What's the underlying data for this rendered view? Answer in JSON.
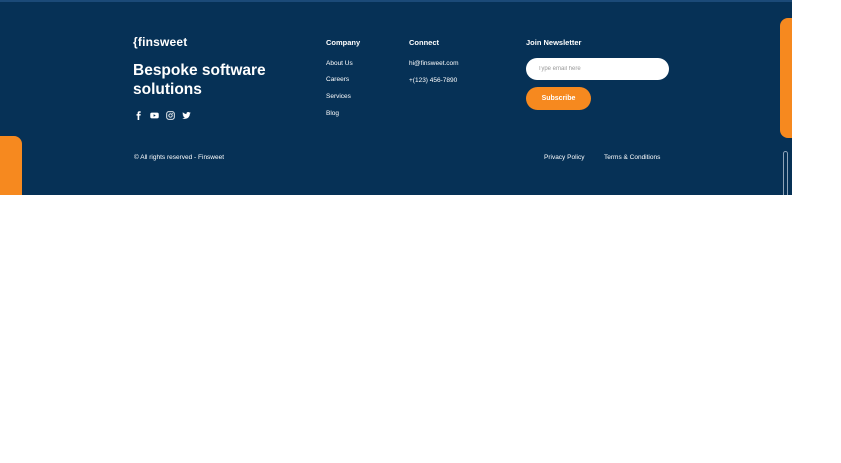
{
  "brand": {
    "logo": "{finsweet",
    "tagline": "Bespoke software solutions"
  },
  "socials": [
    "facebook-icon",
    "youtube-icon",
    "instagram-icon",
    "twitter-icon"
  ],
  "company": {
    "title": "Company",
    "links": [
      "About Us",
      "Careers",
      "Services",
      "Blog"
    ]
  },
  "connect": {
    "title": "Connect",
    "email": "hi@finsweet.com",
    "phone": "+(123) 456-7890"
  },
  "newsletter": {
    "title": "Join Newsletter",
    "placeholder": "Type email here",
    "button": "Subscribe"
  },
  "legal": {
    "copyright": "© All rights reserved - Finsweet",
    "privacy": "Privacy Policy",
    "terms": "Terms & Conditions"
  },
  "colors": {
    "background": "#063156",
    "accent": "#f6891f",
    "text": "#ffffff"
  }
}
